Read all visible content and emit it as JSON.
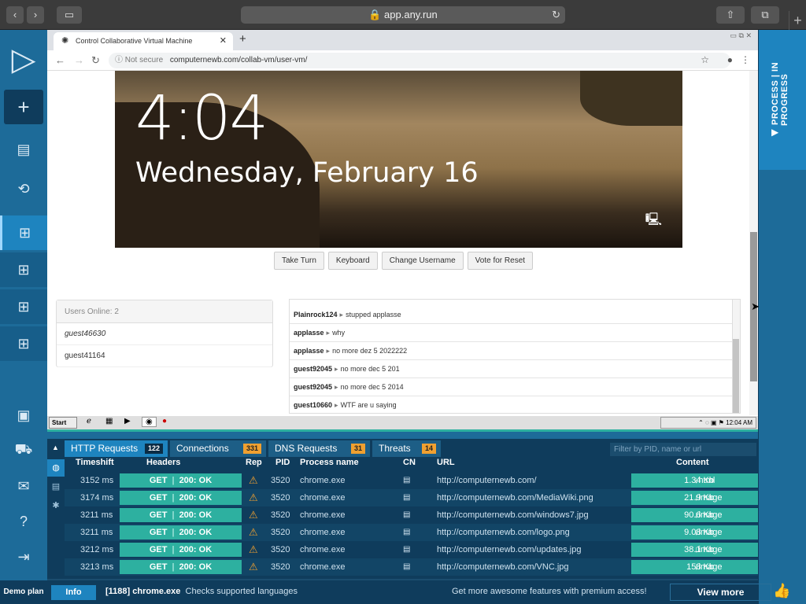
{
  "browser": {
    "url": "app.any.run",
    "lock": "🔒",
    "reload": "↻",
    "back": "‹",
    "forward": "›",
    "sidebar_toggle": "▭",
    "share": "⇧",
    "tabs": "⧉",
    "new": "+"
  },
  "sidebar": {
    "logo": "▷",
    "new_task": "+",
    "demo": "Demo plan"
  },
  "rightbar": {
    "label": "◀  PROCESS | IN PROGRESS"
  },
  "vm": {
    "tab_title": "Control Collaborative Virtual Machine",
    "tab_close": "✕",
    "new_tab": "+",
    "window_controls": "▭ ⧉ ✕",
    "not_secure": "ⓘ  Not secure",
    "address": "computernewb.com/collab-vm/user-vm/",
    "lock_time": "4:04",
    "lock_date": "Wednesday, February 16",
    "buttons": [
      "Take Turn",
      "Keyboard",
      "Change Username",
      "Vote for Reset"
    ],
    "users_header": "Users Online: 2",
    "users": [
      "guest46630",
      "guest41164"
    ],
    "chat": [
      {
        "user": "Plainrock124",
        "text": "stupped applasse"
      },
      {
        "user": "applasse",
        "text": "why"
      },
      {
        "user": "applasse",
        "text": "no more dez 5 2022222"
      },
      {
        "user": "guest92045",
        "text": "no more dec 5 201"
      },
      {
        "user": "guest92045",
        "text": "no more dec 5 2014"
      },
      {
        "user": "guest10660",
        "text": "WTF are u saying"
      }
    ],
    "taskbar_start": "Start",
    "taskbar_clock": "12:04 AM"
  },
  "panel": {
    "tabs": [
      {
        "label": "HTTP Requests",
        "count": "122"
      },
      {
        "label": "Connections",
        "count": "331"
      },
      {
        "label": "DNS Requests",
        "count": "31"
      },
      {
        "label": "Threats",
        "count": "14"
      }
    ],
    "filter_placeholder": "Filter by PID, name or url",
    "headers": {
      "timeshift": "Timeshift",
      "headers": "Headers",
      "rep": "Rep",
      "pid": "PID",
      "process": "Process name",
      "cn": "CN",
      "url": "URL",
      "content": "Content"
    },
    "rows": [
      {
        "time": "3152 ms",
        "method": "GET",
        "status": "200: OK",
        "pid": "3520",
        "process": "chrome.exe",
        "url": "http://computernewb.com/",
        "size": "1.34 Kb",
        "type": "html"
      },
      {
        "time": "3174 ms",
        "method": "GET",
        "status": "200: OK",
        "pid": "3520",
        "process": "chrome.exe",
        "url": "http://computernewb.com/MediaWiki.png",
        "size": "21.9 Kb",
        "type": "image"
      },
      {
        "time": "3211 ms",
        "method": "GET",
        "status": "200: OK",
        "pid": "3520",
        "process": "chrome.exe",
        "url": "http://computernewb.com/windows7.jpg",
        "size": "90.6 Kb",
        "type": "image"
      },
      {
        "time": "3211 ms",
        "method": "GET",
        "status": "200: OK",
        "pid": "3520",
        "process": "chrome.exe",
        "url": "http://computernewb.com/logo.png",
        "size": "9.08 Kb",
        "type": "image"
      },
      {
        "time": "3212 ms",
        "method": "GET",
        "status": "200: OK",
        "pid": "3520",
        "process": "chrome.exe",
        "url": "http://computernewb.com/updates.jpg",
        "size": "38.1 Kb",
        "type": "image"
      },
      {
        "time": "3213 ms",
        "method": "GET",
        "status": "200: OK",
        "pid": "3520",
        "process": "chrome.exe",
        "url": "http://computernewb.com/VNC.jpg",
        "size": "158 Kb",
        "type": "image"
      }
    ]
  },
  "infobar": {
    "button": "Info",
    "process": "[1188] chrome.exe",
    "message": "Checks supported languages",
    "promo": "Get more awesome features with premium access!",
    "view_more": "View more"
  },
  "colors": {
    "accent": "#1e84bf",
    "teal": "#2db0a0",
    "warning": "#f0a030",
    "panel_bg": "#0f3c5c"
  }
}
